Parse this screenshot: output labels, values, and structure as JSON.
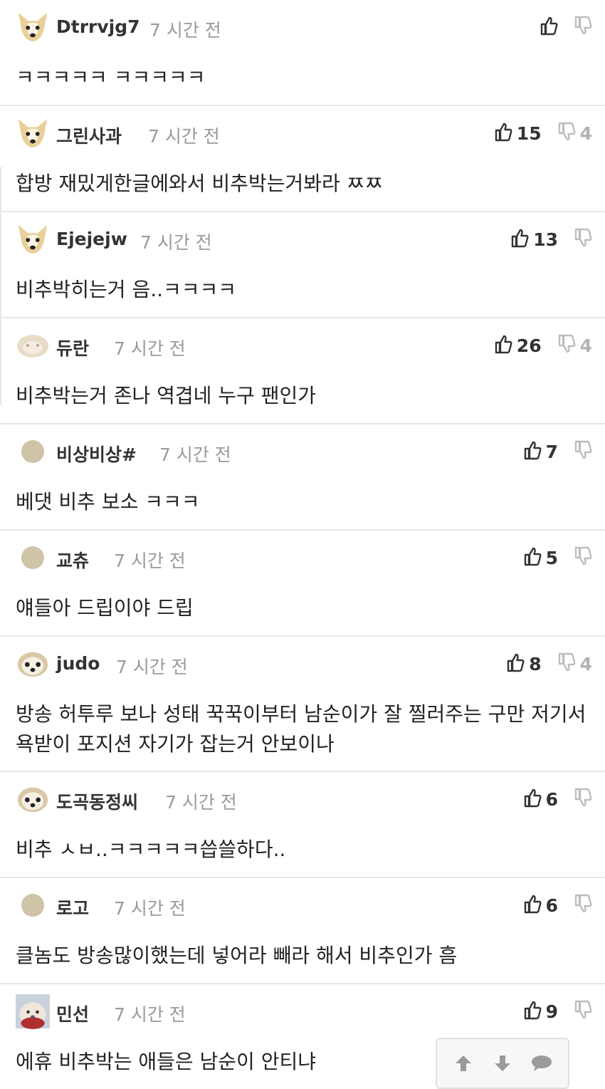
{
  "comments": [
    {
      "user": "Dtrrvjg7",
      "time": "7 시간 전",
      "likes": "",
      "dislikes": "",
      "text": "ㅋㅋㅋㅋㅋ ㅋㅋㅋㅋㅋ",
      "avatar_icon": "dog-avatar-icon"
    },
    {
      "user": "그린사과",
      "time": "7 시간 전",
      "likes": "15",
      "dislikes": "4",
      "text": "합방 재밌게한글에와서 비추박는거봐라 ㅉㅉ",
      "avatar_icon": "dog-avatar-icon"
    },
    {
      "user": "Ejejejw",
      "time": "7 시간 전",
      "likes": "13",
      "dislikes": "",
      "text": "비추박히는거 음..ㅋㅋㅋㅋ",
      "avatar_icon": "dog-avatar-icon"
    },
    {
      "user": "듀란",
      "time": "7 시간 전",
      "likes": "26",
      "dislikes": "4",
      "text": "비추박는거 존나 역겹네 누구 팬인가",
      "avatar_icon": "blob-avatar-icon"
    },
    {
      "user": "비상비상#",
      "time": "7 시간 전",
      "likes": "7",
      "dislikes": "",
      "text": "베댓 비추 보소 ㅋㅋㅋ",
      "avatar_icon": "circle-avatar-icon"
    },
    {
      "user": "교츄",
      "time": "7 시간 전",
      "likes": "5",
      "dislikes": "",
      "text": "얘들아 드립이야 드립",
      "avatar_icon": "circle-avatar-icon"
    },
    {
      "user": "judo",
      "time": "7 시간 전",
      "likes": "8",
      "dislikes": "4",
      "text": "방송 허투루 보나 성태 꾹꾹이부터 남순이가 잘 찔러주는 구만 저기서 욕받이 포지션 자기가 잡는거 안보이나",
      "avatar_icon": "puppy-avatar-icon"
    },
    {
      "user": "도곡동정씨",
      "time": "7 시간 전",
      "likes": "6",
      "dislikes": "",
      "text": "비추 ㅅㅂ..ㅋㅋㅋㅋㅋ씁쓸하다..",
      "avatar_icon": "puppy-avatar-icon"
    },
    {
      "user": "로고",
      "time": "7 시간 전",
      "likes": "6",
      "dislikes": "",
      "text": "클놈도 방송많이했는데 넣어라 빼라 해서 비추인가 흠",
      "avatar_icon": "circle-avatar-icon"
    },
    {
      "user": "민선",
      "time": "7 시간 전",
      "likes": "9",
      "dislikes": "",
      "text": "에휴 비추박는 애들은 남순이 안티냐",
      "avatar_icon": "photo-avatar-icon"
    }
  ],
  "toolbar": {
    "up_icon": "arrow-up-icon",
    "down_icon": "arrow-down-icon",
    "comment_icon": "speech-bubble-icon"
  },
  "colors": {
    "separator": "#e6e6e6",
    "time": "#9a9a9a",
    "dislike": "#b3b3b3",
    "avatar_tan": "#cfc3a8"
  }
}
